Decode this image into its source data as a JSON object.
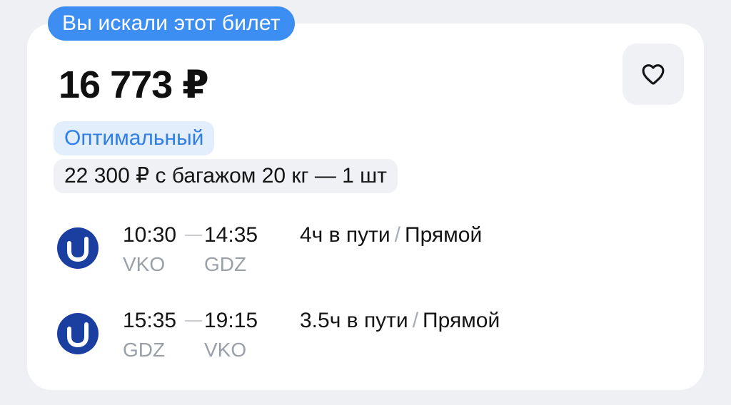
{
  "badge": {
    "searched": "Вы искали этот билет"
  },
  "offer": {
    "price": "16 773 ₽",
    "favorite_icon": "heart-outline-icon"
  },
  "tags": {
    "optimal": "Оптимальный",
    "baggage": "22 300 ₽ с багажом 20 кг — 1 шт"
  },
  "flights": [
    {
      "airline_icon": "utair-logo",
      "departure_time": "10:30",
      "arrival_time": "14:35",
      "departure_code": "VKO",
      "arrival_code": "GDZ",
      "duration": "4ч в пути",
      "separator": "/",
      "type": "Прямой"
    },
    {
      "airline_icon": "utair-logo",
      "departure_time": "15:35",
      "arrival_time": "19:15",
      "departure_code": "GDZ",
      "arrival_code": "VKO",
      "duration": "3.5ч в пути",
      "separator": "/",
      "type": "Прямой"
    }
  ],
  "colors": {
    "accent": "#3d8ef2",
    "tag_optimal_bg": "#e3eefc",
    "tag_optimal_text": "#2f7fe6",
    "airline_blue": "#1b3fa0",
    "muted_text": "#9aa0a8"
  }
}
